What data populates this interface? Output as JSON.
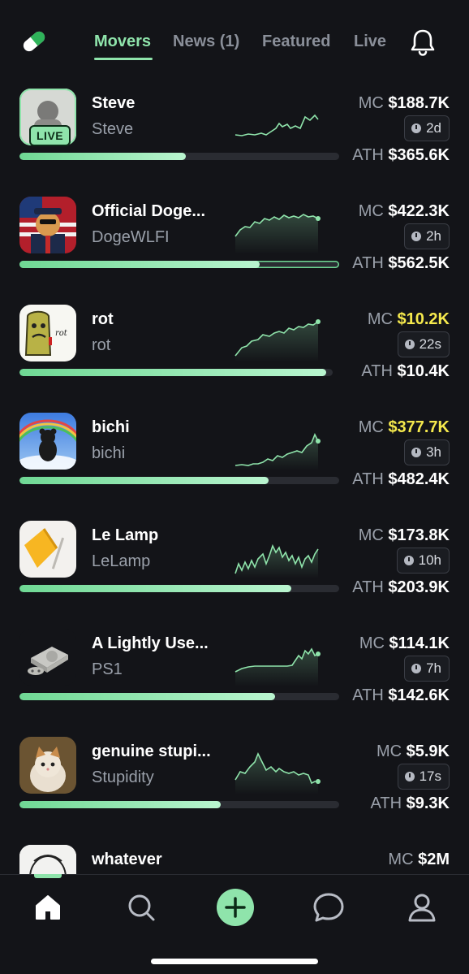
{
  "header": {
    "logo_icon": "pill-icon",
    "tabs": [
      {
        "label": "Movers",
        "active": true
      },
      {
        "label": "News (1)",
        "active": false
      },
      {
        "label": "Featured",
        "active": false
      },
      {
        "label": "Live",
        "active": false
      }
    ],
    "notification_icon": "bell-icon"
  },
  "labels": {
    "mc": "MC",
    "ath": "ATH",
    "live": "LIVE"
  },
  "tokens": [
    {
      "name": "Steve",
      "ticker": "Steve",
      "mc": "$188.7K",
      "mc_hot": false,
      "age": "2d",
      "ath": "$365.6K",
      "progress": 0.52,
      "live": true
    },
    {
      "name": "Official Doge...",
      "ticker": "DogeWLFI",
      "mc": "$422.3K",
      "mc_hot": false,
      "age": "2h",
      "ath": "$562.5K",
      "progress": 0.75,
      "live": false
    },
    {
      "name": "rot",
      "ticker": "rot",
      "mc": "$10.2K",
      "mc_hot": true,
      "age": "22s",
      "ath": "$10.4K",
      "progress": 0.98,
      "live": false
    },
    {
      "name": "bichi",
      "ticker": "bichi",
      "mc": "$377.7K",
      "mc_hot": true,
      "age": "3h",
      "ath": "$482.4K",
      "progress": 0.78,
      "live": false
    },
    {
      "name": "Le Lamp",
      "ticker": "LeLamp",
      "mc": "$173.8K",
      "mc_hot": false,
      "age": "10h",
      "ath": "$203.9K",
      "progress": 0.85,
      "live": false
    },
    {
      "name": "A Lightly Use...",
      "ticker": "PS1",
      "mc": "$114.1K",
      "mc_hot": false,
      "age": "7h",
      "ath": "$142.6K",
      "progress": 0.8,
      "live": false
    },
    {
      "name": "genuine stupi...",
      "ticker": "Stupidity",
      "mc": "$5.9K",
      "mc_hot": false,
      "age": "17s",
      "ath": "$9.3K",
      "progress": 0.63,
      "live": false
    },
    {
      "name": "whatever",
      "ticker": "",
      "mc": "$2M",
      "mc_hot": false,
      "age": "",
      "ath": "",
      "progress": 0,
      "live": false
    }
  ],
  "nav": [
    {
      "name": "home",
      "icon": "home-icon",
      "active": true
    },
    {
      "name": "search",
      "icon": "search-icon",
      "active": false
    },
    {
      "name": "create",
      "icon": "plus-icon",
      "active": false
    },
    {
      "name": "chat",
      "icon": "chat-icon",
      "active": false
    },
    {
      "name": "profile",
      "icon": "profile-icon",
      "active": false
    }
  ],
  "colors": {
    "accent": "#8fe4ab",
    "hot": "#f5e94d",
    "background": "#131418"
  }
}
